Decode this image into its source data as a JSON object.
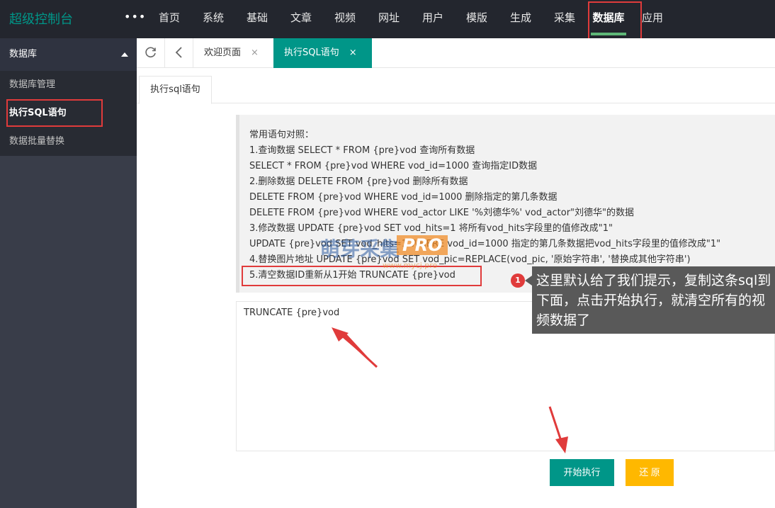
{
  "app": {
    "title": "超级控制台",
    "more": "•••"
  },
  "nav": [
    "首页",
    "系统",
    "基础",
    "文章",
    "视频",
    "网址",
    "用户",
    "模版",
    "生成",
    "采集",
    "数据库",
    "应用"
  ],
  "sidebar": {
    "group": "数据库",
    "items": [
      "数据库管理",
      "执行SQL语句",
      "数据批量替换"
    ]
  },
  "tabs": {
    "welcome": "欢迎页面",
    "current": "执行SQL语句",
    "close": "×"
  },
  "inner_tab": "执行sql语句",
  "hint_lines": [
    "常用语句对照：",
    "1.查询数据 SELECT * FROM {pre}vod 查询所有数据",
    "SELECT * FROM {pre}vod WHERE vod_id=1000 查询指定ID数据",
    "2.删除数据 DELETE FROM {pre}vod 删除所有数据",
    "DELETE FROM {pre}vod WHERE vod_id=1000 删除指定的第几条数据",
    "DELETE FROM {pre}vod WHERE vod_actor LIKE '%刘德华%' vod_actor\"刘德华\"的数据",
    "3.修改数据 UPDATE {pre}vod SET vod_hits=1 将所有vod_hits字段里的值修改成\"1\"",
    "UPDATE {pre}vod SET vod_hits=1 WHERE vod_id=1000 指定的第几条数据把vod_hits字段里的值修改成\"1\"",
    "4.替换图片地址 UPDATE {pre}vod SET vod_pic=REPLACE(vod_pic, '原始字符串', '替换成其他字符串')",
    "5.清空数据ID重新从1开始 TRUNCATE {pre}vod"
  ],
  "sql_value": "TRUNCATE {pre}vod",
  "buttons": {
    "run": "开始执行",
    "reset": "还 原"
  },
  "watermark": {
    "text": "萌芽采集",
    "badge": "PRO",
    "url": "www.mycj.pro"
  },
  "annotation": {
    "number": "1",
    "text": "这里默认给了我们提示，复制这条sql到下面，点击开始执行，就清空所有的视频数据了"
  },
  "colors": {
    "accent": "#009688",
    "warning": "#ffb800",
    "highlight": "#e03b3b",
    "topbar": "#23262e",
    "sidebar": "#393d49"
  },
  "icons": {
    "refresh": "refresh-icon",
    "back": "chevron-left-icon"
  }
}
